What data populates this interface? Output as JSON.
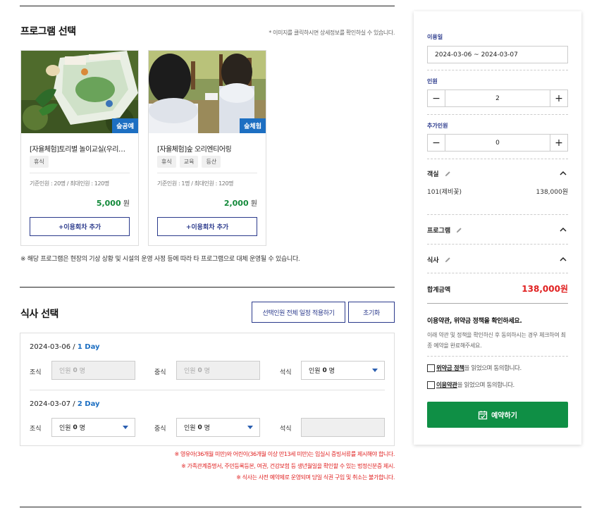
{
  "program": {
    "title": "프로그램 선택",
    "hint": "* 이미지를 클릭하시면 상세정보를 확인하실 수 있습니다.",
    "cards": [
      {
        "badge": "숲공예",
        "name": "[자율체험]토리별 놀이교실(우리…",
        "tags": [
          "휴식"
        ],
        "capacity": "기준인원 : 20명 / 최대인원 : 120명",
        "price": "5,000",
        "unit": "원",
        "add_label": "+이용회차 추가"
      },
      {
        "badge": "숲체험",
        "name": "[자율체험]숲 오리엔티어링",
        "tags": [
          "휴식",
          "교육",
          "등산"
        ],
        "capacity": "기준인원 : 1명 / 최대인원 : 120명",
        "price": "2,000",
        "unit": "원",
        "add_label": "+이용회차 추가"
      }
    ],
    "notice": "※ 해당 프로그램은 현장의 기상 상황 및 시설의 운영 사정 등에 따라 타 프로그램으로 대체 운영될 수 있습니다."
  },
  "meal": {
    "title": "식사 선택",
    "apply_all_label": "선택인원 전체 일정 적용하기",
    "reset_label": "초기화",
    "days": [
      {
        "date": "2024-03-06",
        "sep": " / ",
        "day": "1 Day",
        "meals": [
          {
            "label": "조식",
            "prefix": "인원",
            "count": "0",
            "suffix": "명",
            "enabled": false
          },
          {
            "label": "중식",
            "prefix": "인원",
            "count": "0",
            "suffix": "명",
            "enabled": false
          },
          {
            "label": "석식",
            "prefix": "인원",
            "count": "0",
            "suffix": "명",
            "enabled": true
          }
        ]
      },
      {
        "date": "2024-03-07",
        "sep": " / ",
        "day": "2 Day",
        "meals": [
          {
            "label": "조식",
            "prefix": "인원",
            "count": "0",
            "suffix": "명",
            "enabled": true
          },
          {
            "label": "중식",
            "prefix": "인원",
            "count": "0",
            "suffix": "명",
            "enabled": true
          },
          {
            "label": "석식",
            "prefix": "인원",
            "count": "",
            "suffix": "",
            "enabled": false
          }
        ]
      }
    ],
    "warnings": [
      "※ 영유아(36개월 미만)와 어린이(36개월 이상 만13세 미만)는 입실시 증빙서류를 제시해야 합니다.",
      "※ 가족관계증명서, 주민등록등본, 여권, 건강보험 등 생년월일을 확인할 수 있는 법정신분증 제시.",
      "※ 식사는 사전 예약제로 운영되며 당일 식권 구입 및 취소는 불가합니다."
    ]
  },
  "sidebar": {
    "date_label": "이용일",
    "date_value": "2024-03-06 ~ 2024-03-07",
    "people_label": "인원",
    "people_value": "2",
    "extra_label": "추가인원",
    "extra_value": "0",
    "room_label": "객실",
    "room_name": "101(제비꽃)",
    "room_price": "138,000원",
    "program_label": "프로그램",
    "meal_label": "식사",
    "total_label": "합계금액",
    "total_value": "138,000원",
    "policy_title": "이용약관, 위약금 정책을 확인하세요.",
    "policy_desc": "이래 약관 및 정책을 확인하신 후 동의하시는 경우 체크하여 최종 예약을 완료해주세요.",
    "agree_refund_link": "위약금 정책",
    "agree_refund_rest": "을 읽었으며 동의합니다.",
    "agree_terms_link": "이용약관",
    "agree_terms_rest": "을 읽었으며 동의합니다.",
    "reserve_label": "예약하기"
  },
  "colors": {
    "accent": "#2b3a8c",
    "price_green": "#138a3a",
    "badge_blue": "#1d6fc2",
    "red": "#e02020",
    "reserve_green": "#0f8f45"
  }
}
